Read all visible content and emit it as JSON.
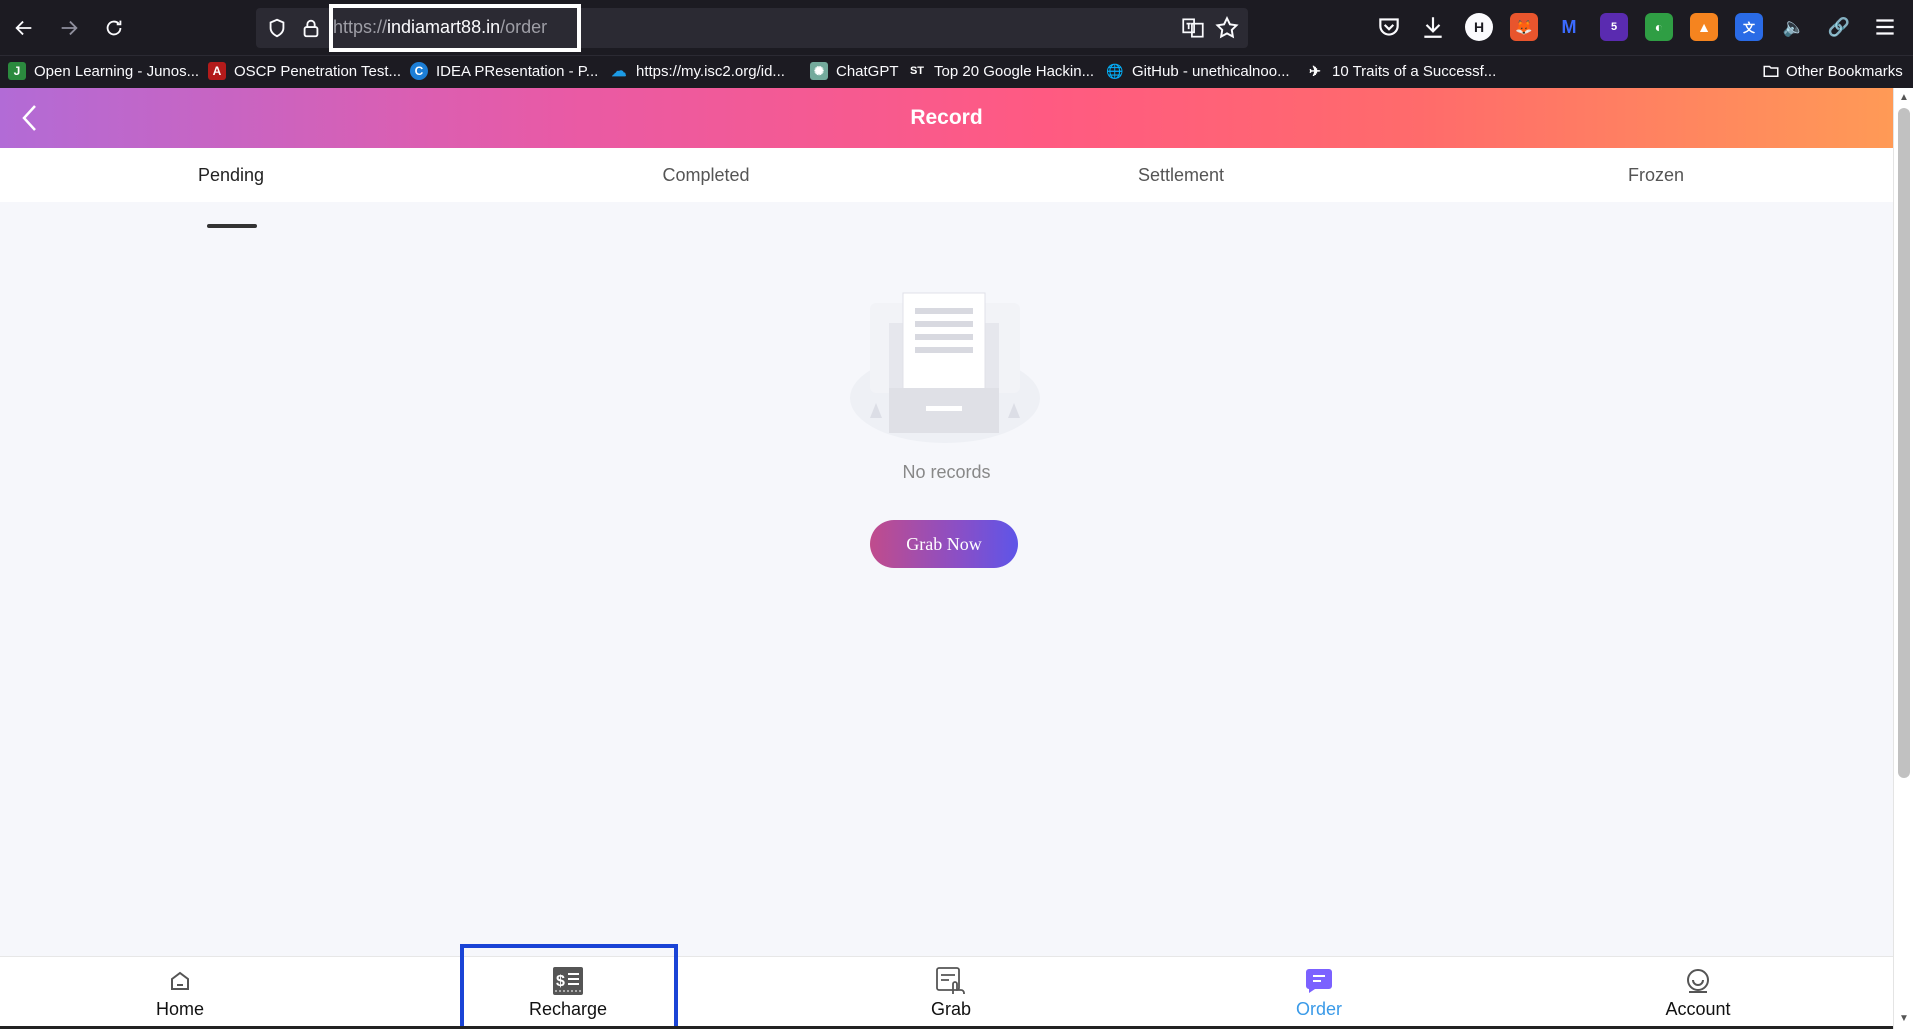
{
  "browser": {
    "url_prefix": "https://",
    "url_domain": "indiamart88.in",
    "url_path": "/order",
    "toolbar_icons": [
      "back-icon",
      "forward-icon",
      "reload-icon",
      "shield-icon",
      "lock-icon",
      "translate-icon",
      "star-icon",
      "pocket-icon",
      "download-icon",
      "menu-icon"
    ],
    "extension_badge": "5",
    "extension_letter": "H",
    "bookmarks": [
      {
        "label": "Open Learning - Junos...",
        "icon": "J"
      },
      {
        "label": "OSCP Penetration Test...",
        "icon": "A"
      },
      {
        "label": "IDEA PResentation - P...",
        "icon": "C"
      },
      {
        "label": "https://my.isc2.org/id...",
        "icon": "☁"
      },
      {
        "label": "ChatGPT",
        "icon": "✺"
      },
      {
        "label": "Top 20 Google Hackin...",
        "icon": "ST"
      },
      {
        "label": "GitHub - unethicalnoo...",
        "icon": "🌐"
      },
      {
        "label": "10 Traits of a Successf...",
        "icon": "✈"
      }
    ],
    "other_bookmarks": "Other Bookmarks"
  },
  "header": {
    "title": "Record"
  },
  "tabs": [
    {
      "label": "Pending",
      "active": true
    },
    {
      "label": "Completed",
      "active": false
    },
    {
      "label": "Settlement",
      "active": false
    },
    {
      "label": "Frozen",
      "active": false
    }
  ],
  "empty": {
    "text": "No records",
    "button": "Grab Now"
  },
  "tabbar": [
    {
      "label": "Home",
      "icon": "home-icon",
      "active": false
    },
    {
      "label": "Recharge",
      "icon": "recharge-icon",
      "active": false
    },
    {
      "label": "Grab",
      "icon": "grab-icon",
      "active": false
    },
    {
      "label": "Order",
      "icon": "order-icon",
      "active": true
    },
    {
      "label": "Account",
      "icon": "account-icon",
      "active": false
    }
  ],
  "colors": {
    "active_tab": "#3a9ae8",
    "highlight_box": "#1a44d6",
    "order_icon": "#7b61ff"
  }
}
